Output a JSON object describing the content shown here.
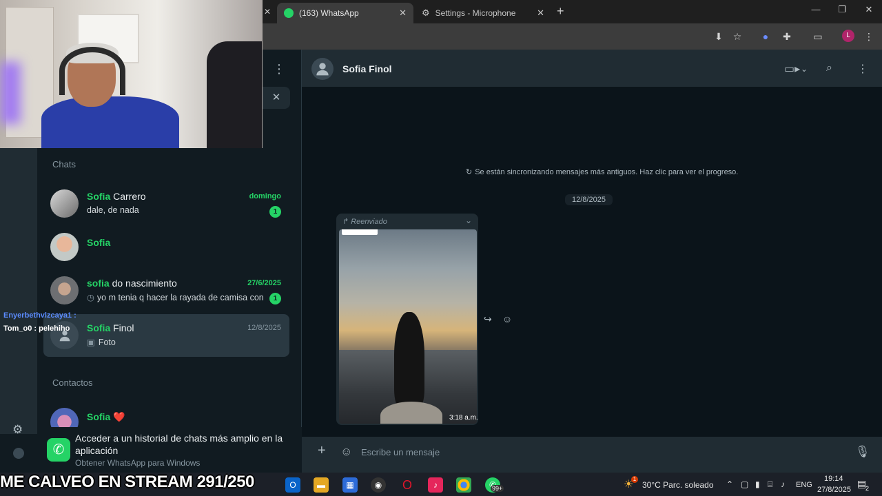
{
  "browser": {
    "tabs": [
      {
        "label": "(163) WhatsApp",
        "active": true
      },
      {
        "label": "Settings - Microphone",
        "active": false
      }
    ],
    "new_tab": "+",
    "close_glyph": "✕",
    "window_controls": {
      "minimize": "—",
      "maximize": "❐",
      "close": "✕"
    },
    "profile_initial": "L"
  },
  "sidebar": {
    "section_chats": "Chats",
    "section_contacts": "Contactos",
    "chats": [
      {
        "name_highlight": "Sofia",
        "name_rest": " Carrero",
        "time": "domingo",
        "preview": "dale, de nada",
        "unread": "1",
        "time_unread": true
      },
      {
        "name_highlight": "Sofia",
        "name_rest": "",
        "time": "",
        "preview": "",
        "unread": "",
        "time_unread": false
      },
      {
        "name_highlight": "sofia",
        "name_rest": " do nascimiento",
        "time": "27/6/2025",
        "preview": "yo m tenia q hacer la rayada de camisa con u...",
        "unread": "1",
        "time_unread": true
      },
      {
        "name_highlight": "Sofia",
        "name_rest": " Finol",
        "time": "12/8/2025",
        "preview": "Foto",
        "unread": "",
        "time_unread": false
      }
    ],
    "contact": {
      "name_highlight": "Sofia",
      "emoji": "❤️"
    },
    "banner": {
      "title": "Acceder a un historial de chats más amplio en la aplicación",
      "subtitle": "Obtener WhatsApp para Windows"
    }
  },
  "chat": {
    "contact_name": "Sofia Finol",
    "sync_note": "Se están sincronizando mensajes más antiguos. Haz clic para ver el progreso.",
    "date_chip": "12/8/2025",
    "message": {
      "forwarded_label": "Reenviado",
      "time": "3:18 a.m."
    },
    "composer_placeholder": "Escribe un mensaje"
  },
  "stream": {
    "title": "ME CALVEO EN STREAM 291/250",
    "chat_lines": [
      {
        "user": "Enyerbethvlzcaya1 :",
        "color": "#5b8cff"
      },
      {
        "user": "Tom_o0 : pelehiho",
        "color": "#ffffff"
      }
    ]
  },
  "taskbar": {
    "weather": "30°C  Parc. soleado",
    "weather_badge": "1",
    "language": "ENG",
    "time": "19:14",
    "date": "27/8/2025",
    "whatsapp_badge": "99+",
    "notification_count": "2"
  },
  "colors": {
    "accent": "#25d366",
    "panel": "#111b21",
    "header": "#202c33",
    "chat_bg": "#0b141a"
  }
}
